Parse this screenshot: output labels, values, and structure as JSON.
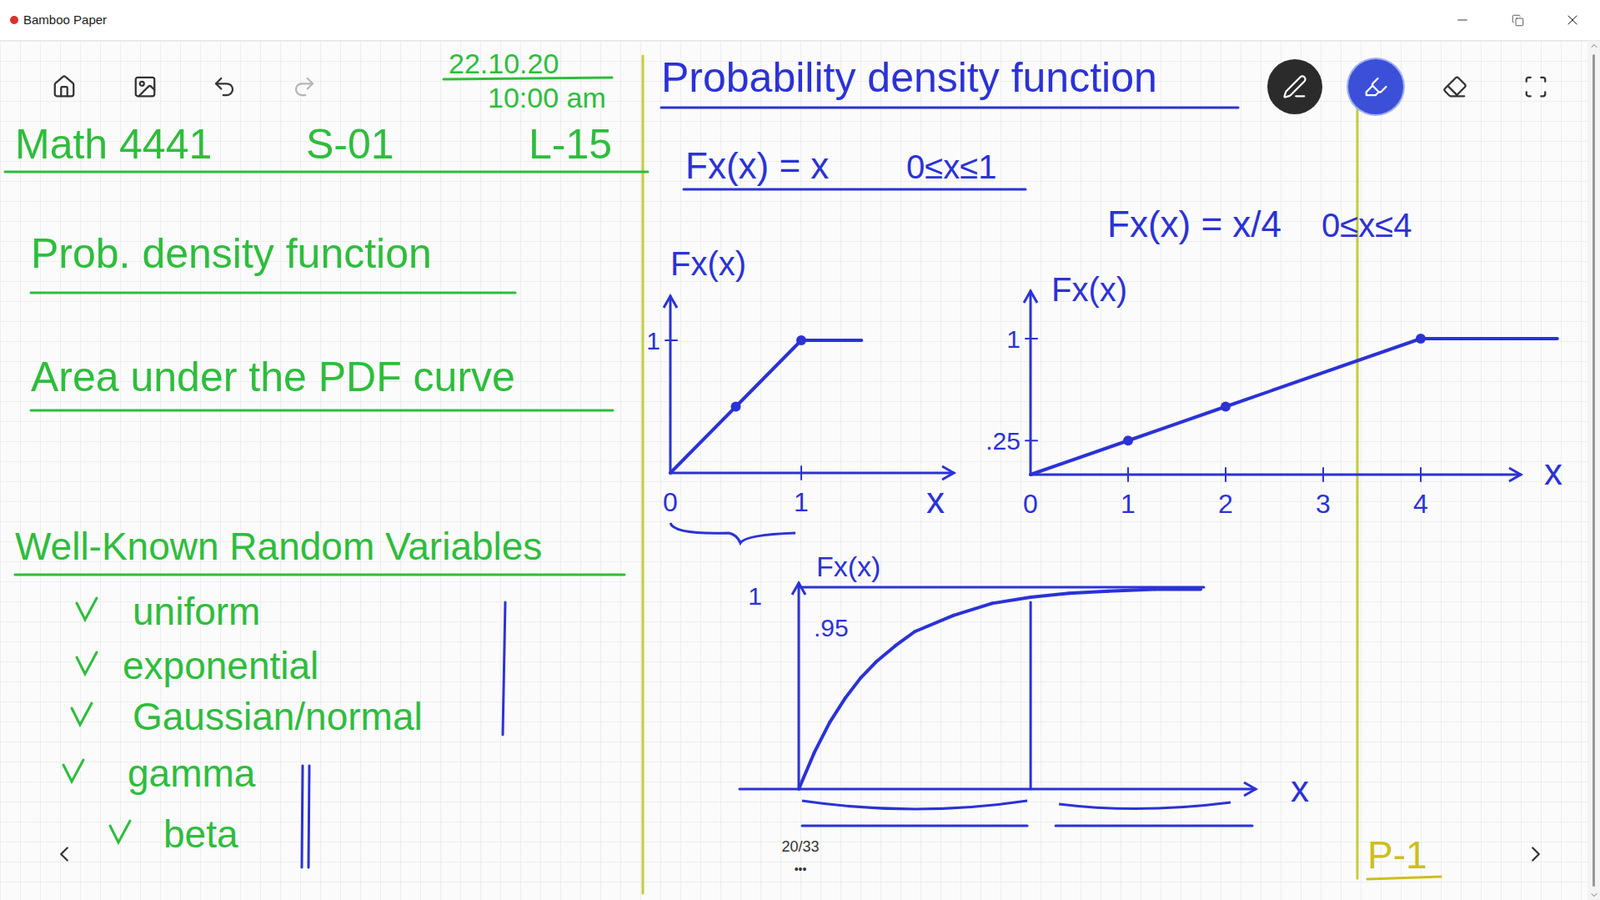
{
  "window": {
    "title": "Bamboo Paper"
  },
  "toolbar": [
    {
      "disabled": false
    },
    {
      "disabled": false
    },
    {
      "disabled": false
    },
    {
      "disabled": true
    }
  ],
  "tools": [
    {
      "selected": false,
      "color": "#2b2b2b"
    },
    {
      "selected": true,
      "color": "#3b4fd8"
    },
    {
      "selected": false
    },
    {
      "selected": false
    }
  ],
  "page": {
    "indicator": "20/33",
    "more": "•••"
  },
  "left_notes": {
    "date": "22.10.20",
    "time": "10:00 am",
    "course": "Math 4441",
    "section": "S-01",
    "lecture": "L-15",
    "topics": [
      "Prob. density function",
      "Area under the PDF curve",
      "Well-Known Random Variables"
    ],
    "variables": [
      {
        "name": "uniform",
        "checked": true
      },
      {
        "name": "exponential",
        "checked": true
      },
      {
        "name": "Gaussian/normal",
        "checked": true
      },
      {
        "name": "gamma",
        "checked": true
      },
      {
        "name": "beta",
        "checked": true
      }
    ]
  },
  "right_notes": {
    "title": "Probability density function",
    "page_tag": "P-1",
    "charts": [
      {
        "formula": "Fx(x) = x",
        "range": "0≤x≤1",
        "y_label": "Fx(x)",
        "x_label": "x",
        "y_ticks": [
          {
            "label": "1",
            "value": 1
          }
        ],
        "x_ticks": [
          {
            "label": "0",
            "value": 0
          },
          {
            "label": "1",
            "value": 1
          }
        ],
        "series": {
          "x": [
            0,
            0.5,
            1,
            1.46
          ],
          "y": [
            0,
            0.5,
            1,
            1
          ],
          "marked": [
            false,
            true,
            true,
            false
          ]
        }
      },
      {
        "formula": "Fx(x) = x/4",
        "range": "0≤x≤4",
        "y_label": "Fx(x)",
        "x_label": "x",
        "y_ticks": [
          {
            "label": "1",
            "value": 1
          },
          {
            "label": ".25",
            "value": 0.25
          }
        ],
        "x_ticks": [
          {
            "label": "0",
            "value": 0
          },
          {
            "label": "1",
            "value": 1
          },
          {
            "label": "2",
            "value": 2
          },
          {
            "label": "3",
            "value": 3
          },
          {
            "label": "4",
            "value": 4
          }
        ],
        "series": {
          "x": [
            0,
            1,
            2,
            4,
            5.4
          ],
          "y": [
            0,
            0.25,
            0.5,
            1,
            1
          ],
          "marked": [
            false,
            true,
            true,
            true,
            false
          ]
        }
      },
      {
        "y_label": "Fx(x)",
        "x_label": "x",
        "y_ticks": [
          {
            "label": "1",
            "value": 1
          },
          {
            "label": ".95",
            "value": 0.95
          }
        ],
        "x_ticks": [],
        "series": {
          "x": [
            0,
            0.2,
            0.4,
            0.6,
            0.8,
            1,
            1.25,
            1.5,
            2,
            2.5,
            3,
            3.5,
            4,
            4.6,
            5.2
          ],
          "y": [
            0,
            0.18,
            0.33,
            0.45,
            0.55,
            0.63,
            0.71,
            0.78,
            0.86,
            0.92,
            0.95,
            0.97,
            0.98,
            0.99,
            0.99
          ],
          "marked": [
            false,
            false,
            false,
            false,
            false,
            false,
            false,
            false,
            false,
            false,
            false,
            false,
            false,
            false,
            false
          ]
        }
      }
    ]
  }
}
